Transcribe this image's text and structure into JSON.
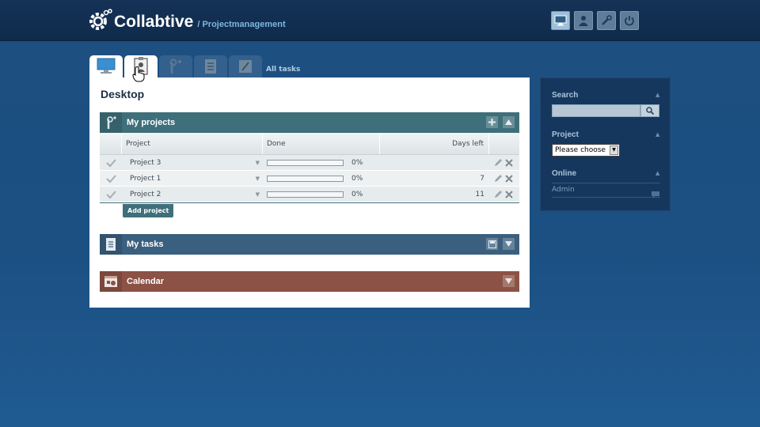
{
  "header": {
    "app_name": "Collabtive",
    "app_sub": "/ Projectmanagement",
    "icons": [
      "desktop-icon",
      "user-icon",
      "wrench-icon",
      "power-icon"
    ]
  },
  "tabs": {
    "items": [
      "desktop-icon",
      "user-profile-icon",
      "projects-icon",
      "tasks-icon",
      "notes-icon"
    ],
    "all_tasks_label": "All tasks"
  },
  "main": {
    "title": "Desktop",
    "projects": {
      "title": "My projects",
      "columns": {
        "project": "Project",
        "done": "Done",
        "days_left": "Days left"
      },
      "rows": [
        {
          "name": "Project 3",
          "done": "0%",
          "done_value": 0,
          "days_left": ""
        },
        {
          "name": "Project 1",
          "done": "0%",
          "done_value": 0,
          "days_left": "7"
        },
        {
          "name": "Project 2",
          "done": "0%",
          "done_value": 0,
          "days_left": "11"
        }
      ],
      "add_label": "Add project"
    },
    "tasks": {
      "title": "My tasks"
    },
    "calendar": {
      "title": "Calendar"
    }
  },
  "sidebar": {
    "search_label": "Search",
    "search_value": "",
    "project_label": "Project",
    "project_select": "Please choose",
    "online_label": "Online",
    "online_user": "Admin"
  },
  "colors": {
    "projects_bar": "#3e6f7a",
    "tasks_bar": "#3b5f7e",
    "calendar_bar": "#8b5245",
    "background": "#1d4f80"
  }
}
